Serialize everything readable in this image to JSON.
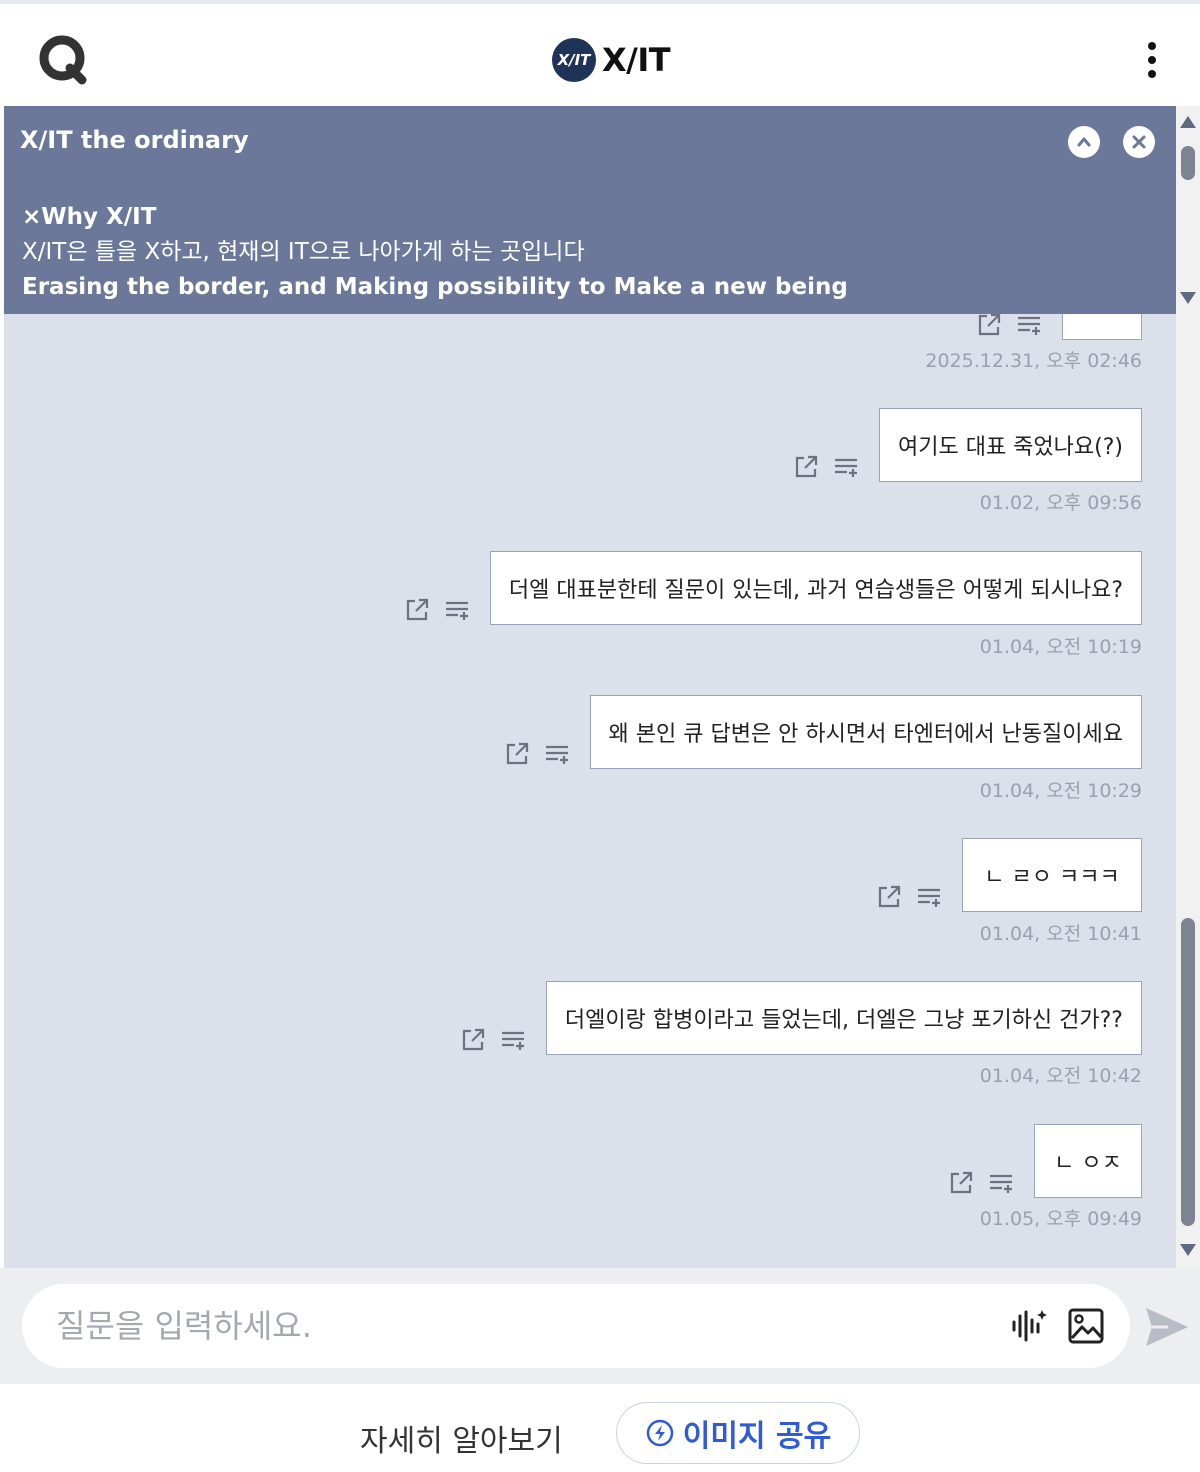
{
  "header": {
    "brand_badge": "X/IT",
    "brand_name": "X/IT"
  },
  "notice": {
    "title": "X/IT the ordinary",
    "line1": "×Why X/IT",
    "line2": "X/IT은 틀을 X하고, 현재의 IT으로 나아가게 하는 곳입니다",
    "line3": "Erasing the border, and Making possibility to Make a new being"
  },
  "messages": [
    {
      "text": "",
      "time": "2025.12.31, 오후 02:46"
    },
    {
      "text": "여기도 대표 죽었나요(?)",
      "time": "01.02, 오후 09:56"
    },
    {
      "text": "더엘 대표분한테 질문이 있는데, 과거 연습생들은 어떻게 되시나요?",
      "time": "01.04, 오전 10:19"
    },
    {
      "text": "왜 본인 큐 답변은 안 하시면서 타엔터에서 난동질이세요",
      "time": "01.04, 오전 10:29"
    },
    {
      "text": "ㄴ ㄹㅇ ㅋㅋㅋ",
      "time": "01.04, 오전 10:41"
    },
    {
      "text": "더엘이랑 합병이라고 들었는데, 더엘은 그냥 포기하신 건가??",
      "time": "01.04, 오전 10:42"
    },
    {
      "text": "ㄴ ㅇㅈ",
      "time": "01.05, 오후 09:49"
    }
  ],
  "input": {
    "placeholder": "질문을 입력하세요."
  },
  "footer": {
    "learn_more": "자세히 알아보기",
    "share_label": "이미지 공유"
  },
  "colors": {
    "banner": "#6b7899",
    "chat_bg": "#dbe0ea",
    "accent": "#2f5bd8"
  }
}
